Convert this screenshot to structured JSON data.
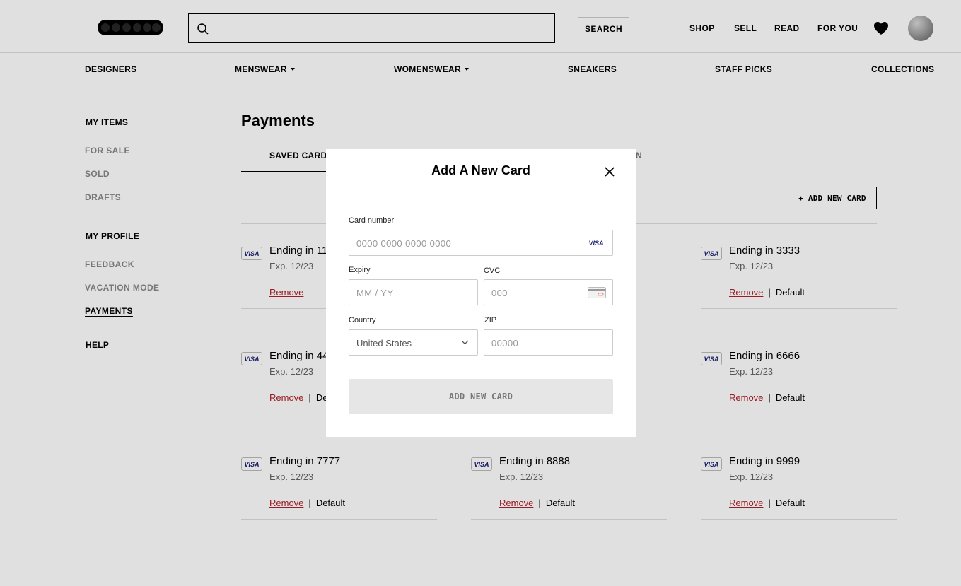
{
  "header": {
    "logo_text": "GRAILED",
    "search_placeholder": "",
    "search_button": "SEARCH",
    "nav": [
      "SHOP",
      "SELL",
      "READ",
      "FOR YOU"
    ]
  },
  "categories": [
    "DESIGNERS",
    "MENSWEAR",
    "WOMENSWEAR",
    "SNEAKERS",
    "STAFF PICKS",
    "COLLECTIONS"
  ],
  "sidebar": {
    "my_items_heading": "MY ITEMS",
    "my_items": [
      "FOR SALE",
      "SOLD",
      "DRAFTS"
    ],
    "my_profile_heading": "MY PROFILE",
    "my_profile": [
      "FEEDBACK",
      "VACATION MODE",
      "PAYMENTS"
    ],
    "help": "HELP"
  },
  "main": {
    "title": "Payments",
    "tabs": {
      "saved_cards": "SAVED CARDS",
      "partial_tab": "N"
    },
    "add_card_button": "+ ADD NEW CARD",
    "remove_label": "Remove",
    "default_label": "Default",
    "cards": [
      {
        "ending": "Ending in 11",
        "exp": "Exp. 12/23",
        "brand": "VISA",
        "default_visible": false
      },
      {
        "ending": "Ending in 3333",
        "exp": "Exp. 12/23",
        "brand": "VISA",
        "default_visible": true
      },
      {
        "ending": "Ending in 44",
        "exp": "Exp. 12/23",
        "brand": "VISA",
        "default_visible": true,
        "default_partial": "Def"
      },
      {
        "ending": "Ending in 6666",
        "exp": "Exp. 12/23",
        "brand": "VISA",
        "default_visible": true
      },
      {
        "ending": "Ending in 7777",
        "exp": "Exp. 12/23",
        "brand": "VISA",
        "default_visible": true
      },
      {
        "ending": "Ending in 8888",
        "exp": "Exp. 12/23",
        "brand": "VISA",
        "default_visible": true
      },
      {
        "ending": "Ending in 9999",
        "exp": "Exp. 12/23",
        "brand": "VISA",
        "default_visible": true
      }
    ]
  },
  "modal": {
    "title": "Add A New Card",
    "card_number_label": "Card number",
    "card_number_placeholder": "0000 0000 0000 0000",
    "card_brand": "VISA",
    "expiry_label": "Expiry",
    "expiry_placeholder": "MM / YY",
    "cvc_label": "CVC",
    "cvc_placeholder": "000",
    "country_label": "Country",
    "country_value": "United States",
    "zip_label": "ZIP",
    "zip_placeholder": "00000",
    "submit_label": "ADD NEW CARD"
  },
  "colors": {
    "remove_red": "#b0202a",
    "visa_blue": "#1a1f71",
    "border": "#dddddd"
  }
}
